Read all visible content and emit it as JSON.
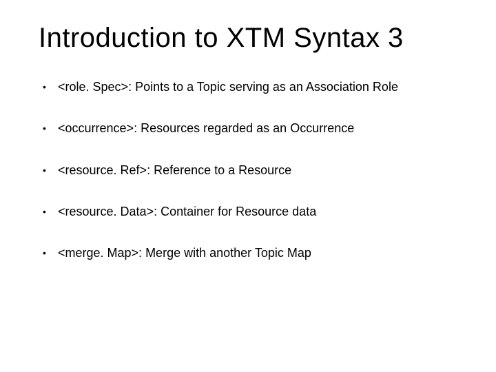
{
  "title": "Introduction to XTM Syntax 3",
  "bullets": [
    "<role. Spec>: Points to a Topic serving as an Association Role",
    "<occurrence>: Resources regarded as an Occurrence",
    "<resource. Ref>: Reference to a Resource",
    "<resource. Data>: Container for Resource data",
    "<merge. Map>: Merge with another Topic Map"
  ]
}
